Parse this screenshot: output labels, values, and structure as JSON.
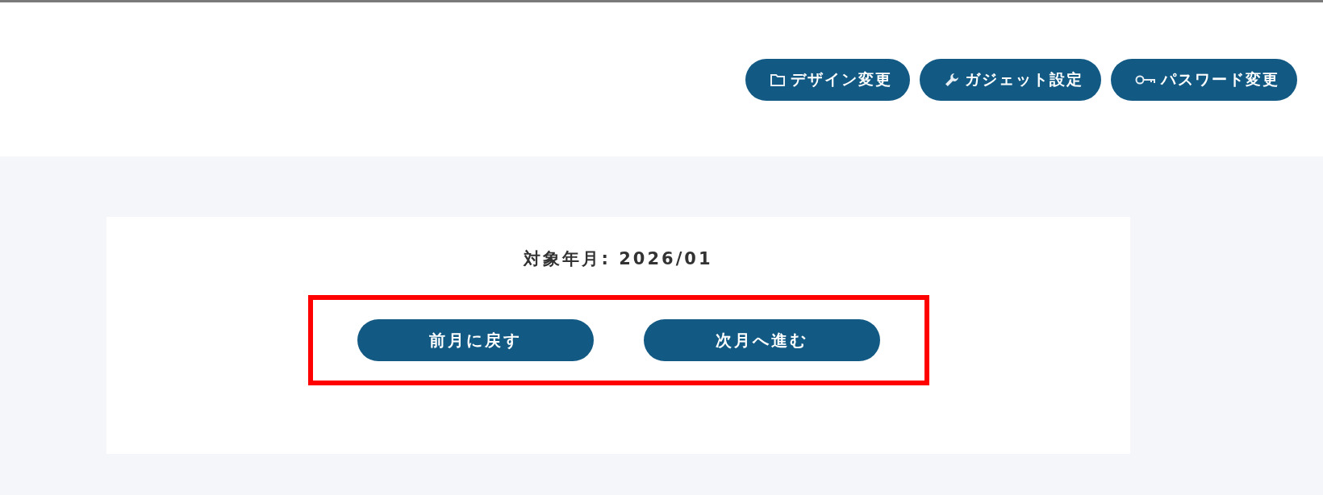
{
  "header_buttons": [
    {
      "label": "デザイン変更"
    },
    {
      "label": "ガジェット設定"
    },
    {
      "label": "パスワード変更"
    }
  ],
  "card": {
    "target_month_label": "対象年月: 2026/01",
    "nav": {
      "highlighted": true,
      "buttons": [
        {
          "label": "前月に戻す"
        },
        {
          "label": "次月へ進む"
        }
      ]
    }
  }
}
